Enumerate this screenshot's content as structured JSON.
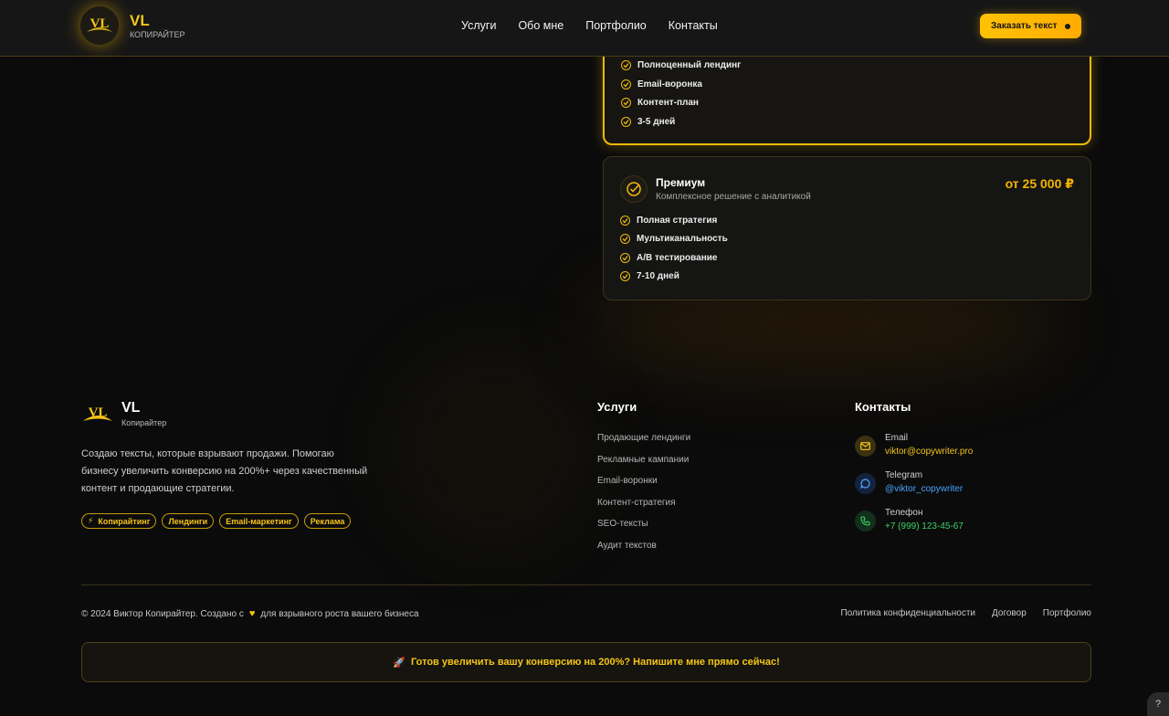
{
  "header": {
    "logo_mark": "VL",
    "logo_title": "VL",
    "logo_subtitle": "КОПИРАЙТЕР",
    "nav": [
      "Услуги",
      "Обо мне",
      "Портфолио",
      "Контакты"
    ],
    "cta_label": "Заказать текст"
  },
  "plan_standard": {
    "features": [
      "Полноценный лендинг",
      "Email-воронка",
      "Контент-план",
      "3-5 дней"
    ]
  },
  "plan_premium": {
    "name": "Премиум",
    "description": "Комплексное решение с аналитикой",
    "price": "от 25 000 ₽",
    "features": [
      "Полная стратегия",
      "Мультиканальность",
      "A/B тестирование",
      "7-10 дней"
    ]
  },
  "footer": {
    "logo_title": "VL",
    "logo_subtitle": "Копирайтер",
    "description": "Создаю тексты, которые взрывают продажи. Помогаю бизнесу увеличить конверсию на 200%+ через качественный контент и продающие стратегии.",
    "tags": [
      "Копирайтинг",
      "Лендинги",
      "Email-маркетинг",
      "Реклама"
    ],
    "services_title": "Услуги",
    "services": [
      "Продающие лендинги",
      "Рекламные кампании",
      "Email-воронки",
      "Контент-стратегия",
      "SEO-тексты",
      "Аудит текстов"
    ],
    "contacts_title": "Контакты",
    "contacts": [
      {
        "label": "Email",
        "value": "viktor@copywriter.pro",
        "color": "#f5c518",
        "icon": "mail-icon"
      },
      {
        "label": "Telegram",
        "value": "@viktor_copywriter",
        "color": "#4aa3ff",
        "icon": "chat-icon"
      },
      {
        "label": "Телефон",
        "value": "+7 (999) 123-45-67",
        "color": "#3ecf6a",
        "icon": "phone-icon"
      }
    ],
    "copyright_before": "© 2024 Виктор Копирайтер. Создано с",
    "copyright_after": "для взрывного роста вашего бизнеса",
    "links": [
      "Политика конфиденциальности",
      "Договор",
      "Портфолио"
    ],
    "cta_banner": "Готов увеличить вашу конверсию на 200%? Напишите мне прямо сейчас!"
  },
  "help_label": "?"
}
